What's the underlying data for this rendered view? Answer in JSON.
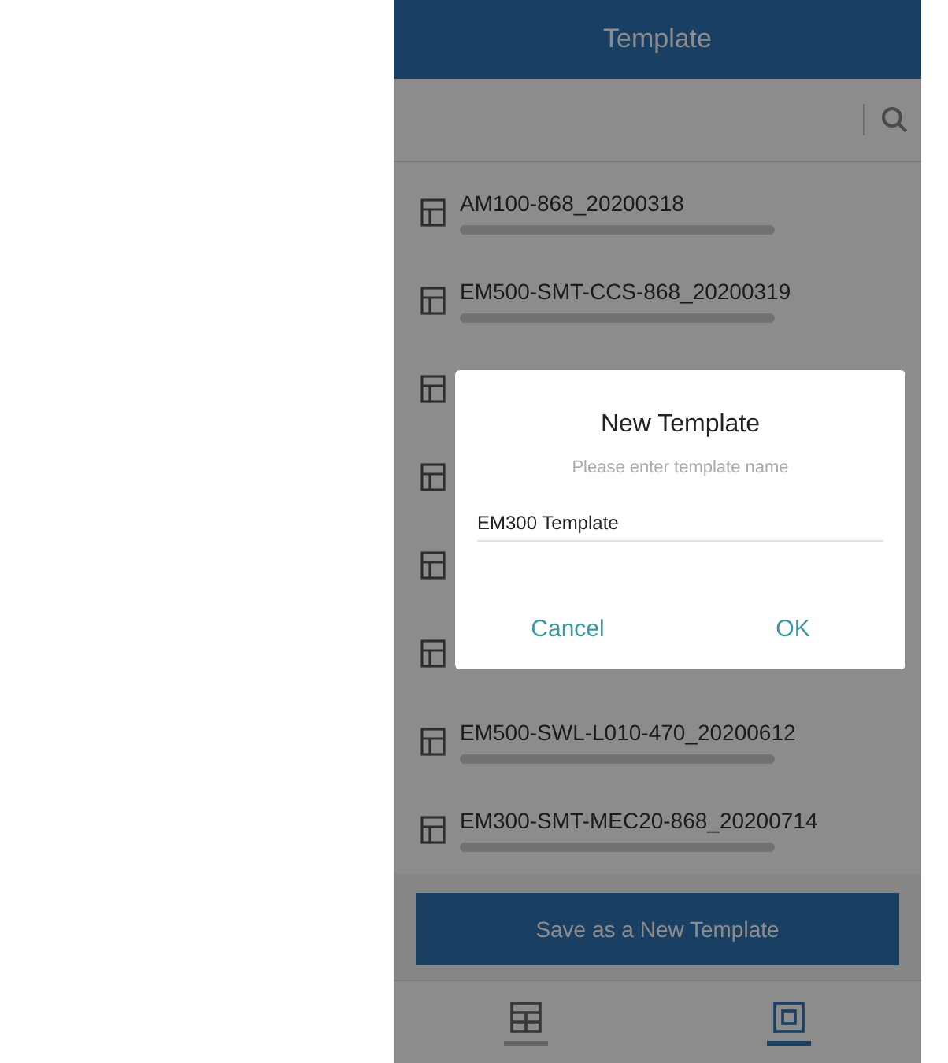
{
  "header": {
    "title": "Template"
  },
  "templates": [
    {
      "kind": "named",
      "title": "AM100-868_20200318"
    },
    {
      "kind": "named",
      "title": "EM500-SMT-CCS-868_20200319"
    },
    {
      "kind": "covered"
    },
    {
      "kind": "covered"
    },
    {
      "kind": "covered"
    },
    {
      "kind": "covered"
    },
    {
      "kind": "named",
      "title": "EM500-SWL-L010-470_20200612"
    },
    {
      "kind": "named",
      "title": "EM300-SMT-MEC20-868_20200714"
    }
  ],
  "save_button": "Save as a New Template",
  "nav": [
    {
      "selected": false
    },
    {
      "selected": true
    }
  ],
  "dialog": {
    "title": "New Template",
    "hint": "Please enter template name",
    "value": "EM300 Template",
    "buttons": [
      "Cancel",
      "OK"
    ]
  }
}
